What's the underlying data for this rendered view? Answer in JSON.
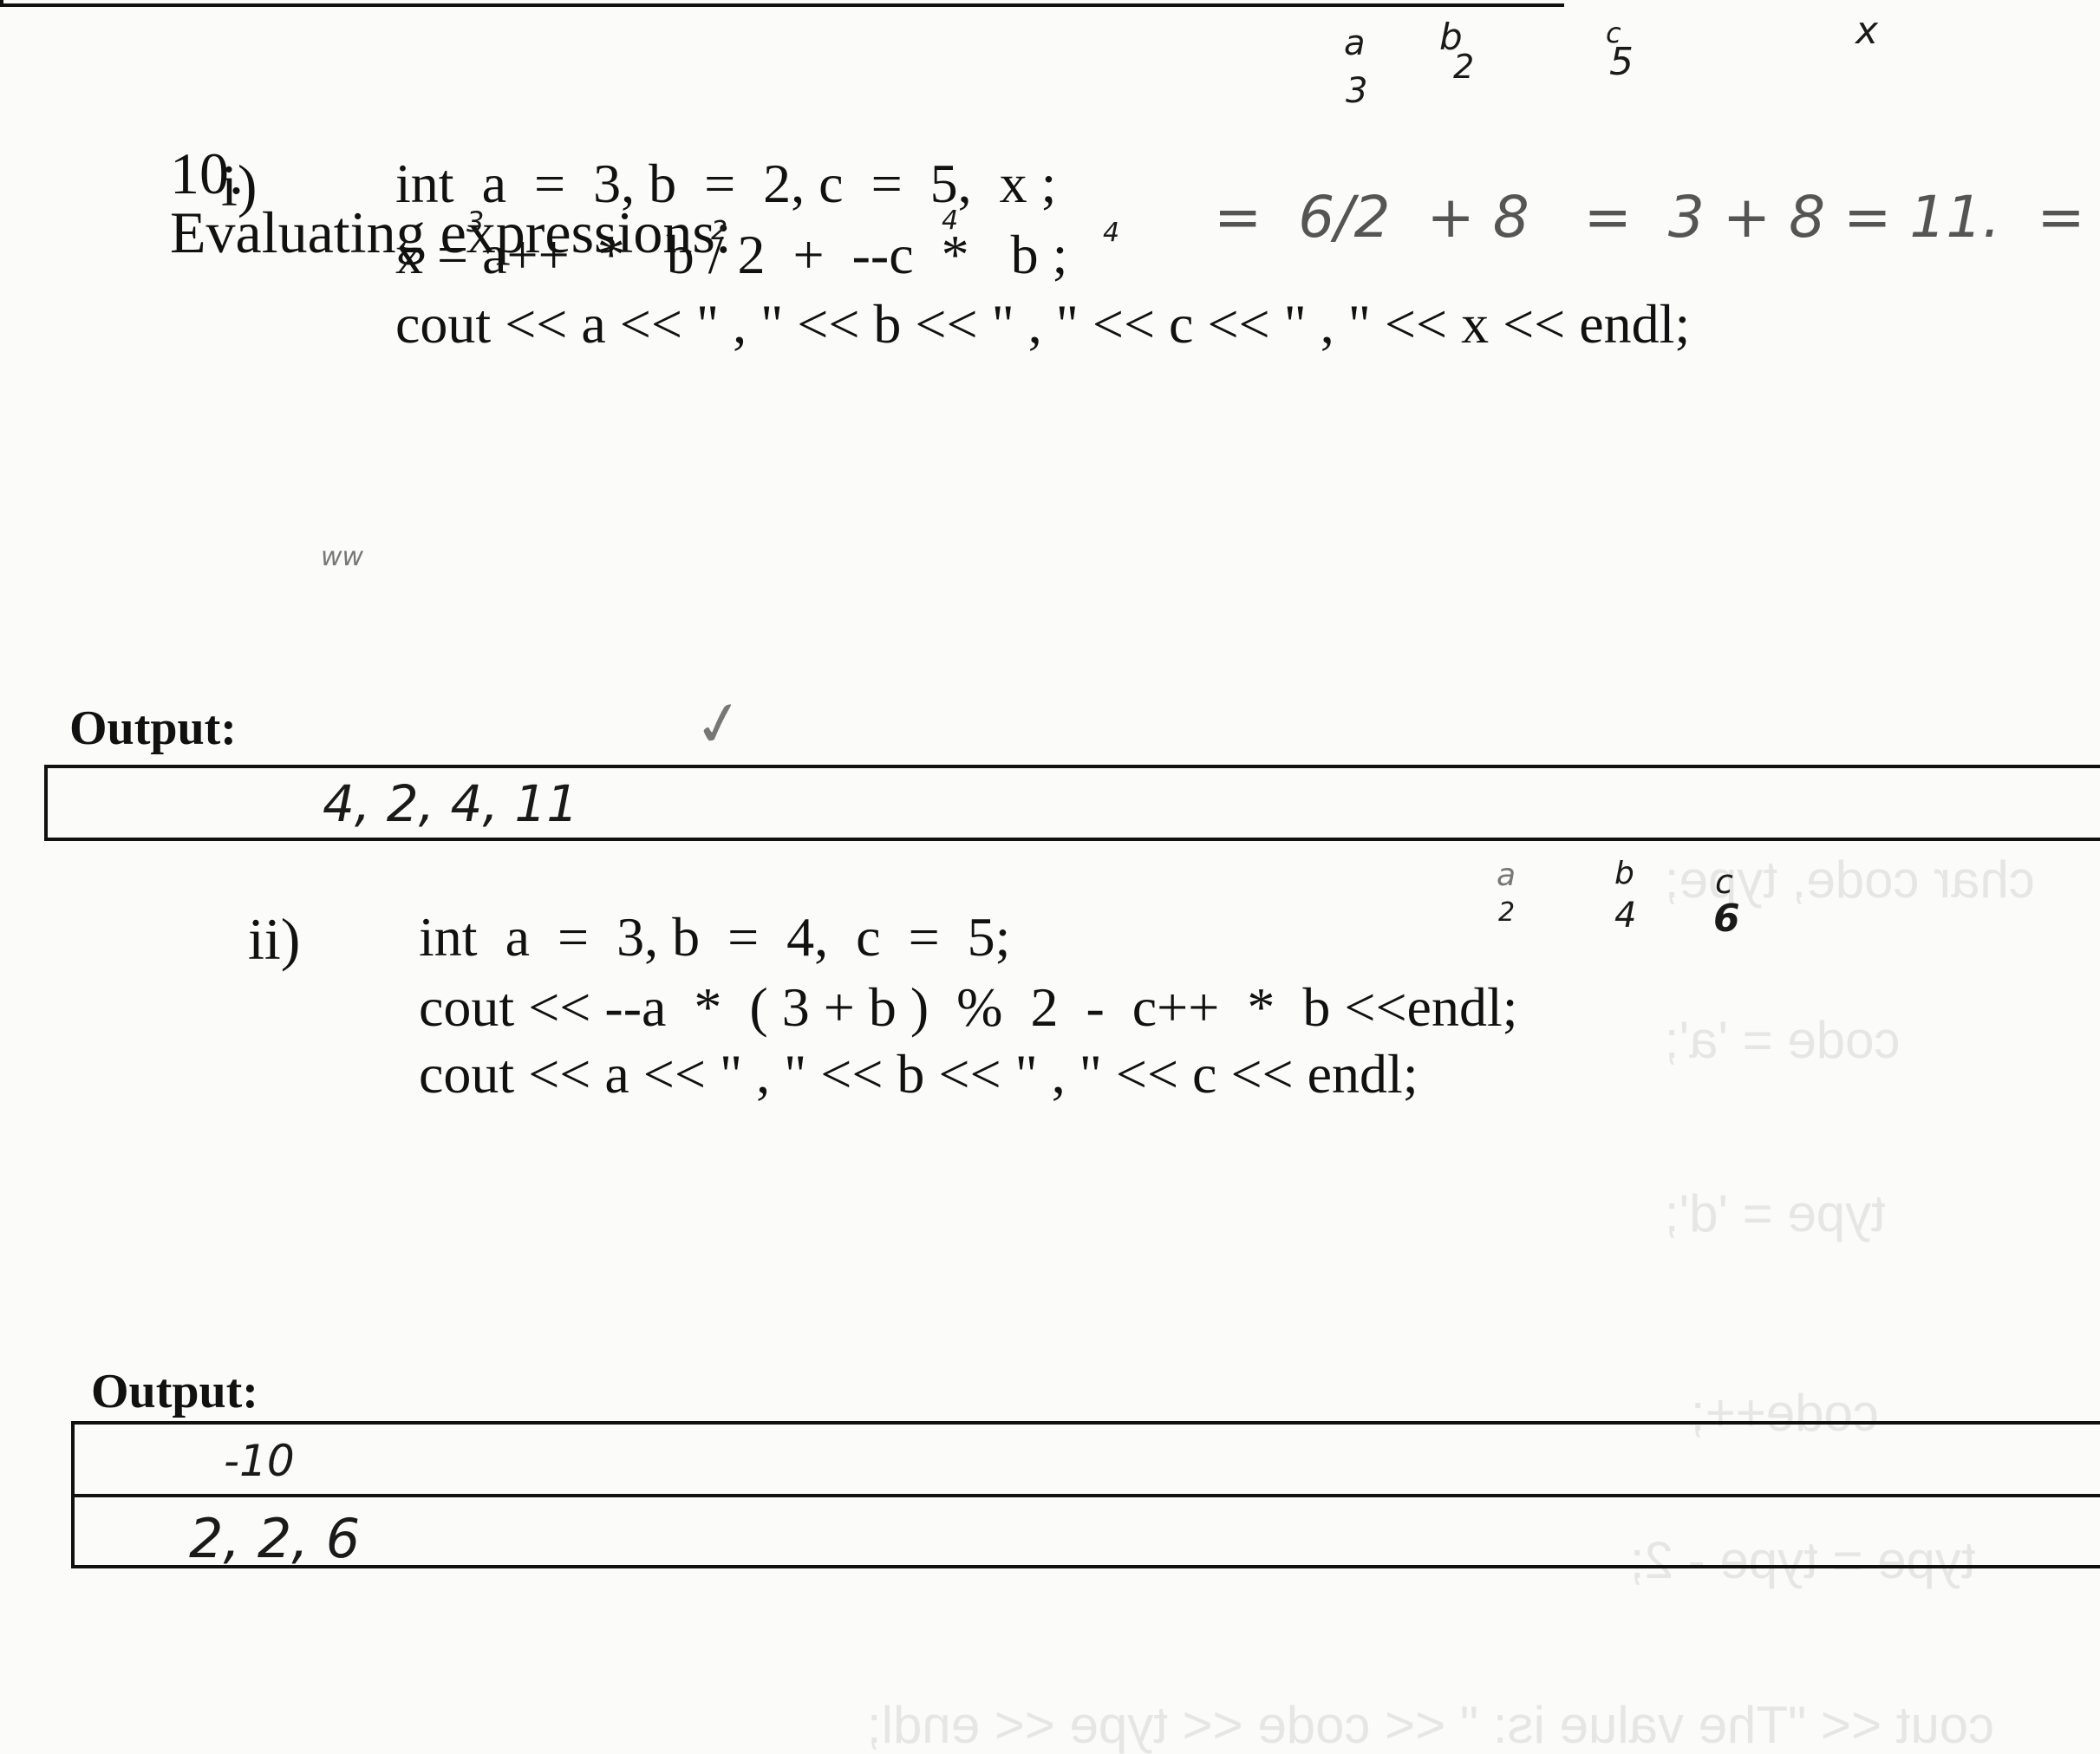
{
  "question": {
    "number": "10.",
    "title": "Evaluating expressions:"
  },
  "part_i": {
    "label": "i)",
    "code_lines": [
      "int  a  =  3, b  =  2, c  =  5,  x ;",
      "x = a++  *   b / 2  +  --c  *   b ;",
      "cout << a << \" , \" << b << \" , \" << c << \" , \" << x << endl;"
    ],
    "output_label": "Output:",
    "output_answer": "4, 2, 4, 11",
    "annotations": {
      "var_a": "a",
      "var_a_val": "3",
      "var_b": "b",
      "var_b_val": "2",
      "var_c": "c",
      "var_c_val": "5",
      "var_x": "x",
      "above_a": "3",
      "above_b": "2",
      "above_c": "4",
      "above_b2": "4",
      "work": "=  6/2  + 8   =  3 + 8 = 11.  =",
      "scribble": "ww",
      "check_mark": "✓"
    }
  },
  "part_ii": {
    "label": "ii)",
    "code_lines": [
      "int  a  =  3, b  =  4,  c  =  5;",
      "cout << --a  *  ( 3 + b )  %  2  -  c++  *  b <<endl;",
      "cout << a << \" , \" << b << \" , \" << c << endl;"
    ],
    "output_label": "Output:",
    "output_answers": [
      "-10",
      "2, 2, 6"
    ],
    "annotations": {
      "var_a": "a",
      "var_a_val": "2",
      "var_b": "b",
      "var_b_val": "4",
      "var_c": "c",
      "var_c_val": "6"
    }
  },
  "bleed_through": [
    "char code, type;",
    "code = 'a';",
    "type = 'd';",
    "code++;",
    "type = type - 2;",
    "cout << \"The value is: \" << code << type << endl;"
  ]
}
